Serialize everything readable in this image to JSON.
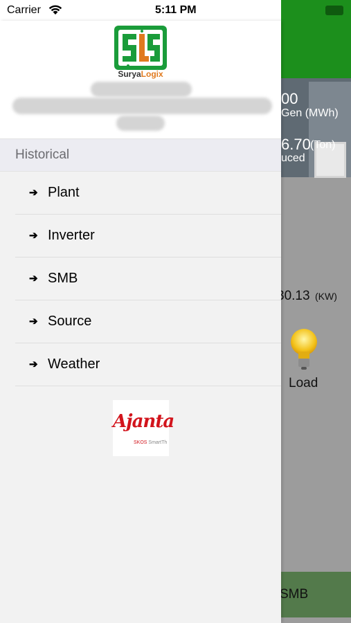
{
  "status_bar": {
    "carrier": "Carrier",
    "time": "5:11 PM"
  },
  "background_app": {
    "stat1_value": "00",
    "stat1_label": "Gen (MWh)",
    "stat2_value": "6.70",
    "stat2_unit": "(Ton)",
    "stat2_label": "uced",
    "power_value": "30.13",
    "power_unit": "(KW)",
    "load_label": "Load",
    "bottom_tab_label": "SMB"
  },
  "drawer": {
    "logo": {
      "brand_prefix": "Surya",
      "brand_suffix": "Logix"
    },
    "section_title": "Historical",
    "menu_items": [
      {
        "icon": "arrow-right-icon",
        "label": "Plant"
      },
      {
        "icon": "arrow-right-icon",
        "label": "Inverter"
      },
      {
        "icon": "arrow-right-icon",
        "label": "SMB"
      },
      {
        "icon": "arrow-right-icon",
        "label": "Source"
      },
      {
        "icon": "arrow-right-icon",
        "label": "Weather"
      }
    ],
    "partner_logo": {
      "name": "Ajanta",
      "tag_red": "SKOS",
      "tag_grey": "SmartTh"
    }
  },
  "colors": {
    "header_green": "#1c8f1c",
    "logo_green": "#1a9c3a",
    "logo_orange": "#e07a1f",
    "ajanta_red": "#d2141c"
  }
}
